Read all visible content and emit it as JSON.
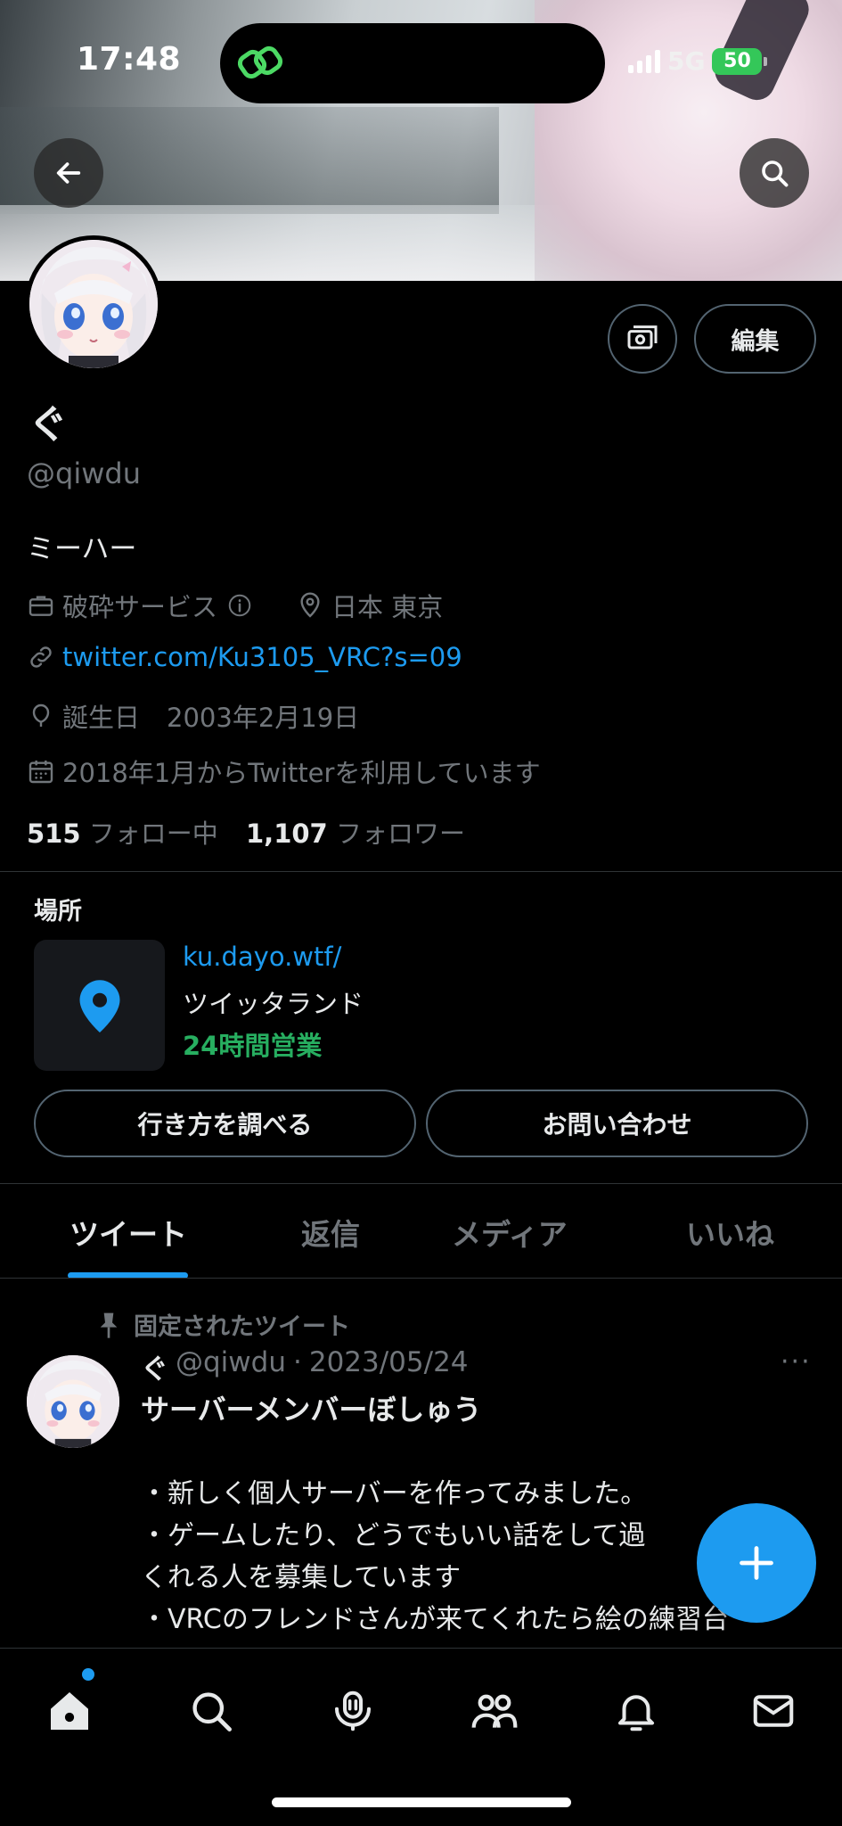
{
  "status_bar": {
    "time": "17:48",
    "network": "5G",
    "battery": "50"
  },
  "profile": {
    "name": "ぐ",
    "handle": "@qiwdu",
    "bio": "ミーハー",
    "category": "破砕サービス",
    "location": "日本 東京",
    "url": "twitter.com/Ku3105_VRC?s=09",
    "birthday_label": "誕生日",
    "birthday": "2003年2月19日",
    "joined": "2018年1月からTwitterを利用しています",
    "following_count": "515",
    "following_label": "フォロー中",
    "followers_count": "1,107",
    "followers_label": "フォロワー"
  },
  "header_buttons": {
    "edit_label": "編集"
  },
  "place": {
    "title": "場所",
    "url": "ku.dayo.wtf/",
    "name": "ツイッタランド",
    "hours": "24時間営業",
    "directions_label": "行き方を調べる",
    "contact_label": "お問い合わせ"
  },
  "tabs": [
    {
      "label": "ツイート",
      "active": true
    },
    {
      "label": "返信",
      "active": false
    },
    {
      "label": "メディア",
      "active": false
    },
    {
      "label": "いいね",
      "active": false
    }
  ],
  "pinned_tweet": {
    "pinned_label": "固定されたツイート",
    "author_name": "ぐ",
    "author_handle": "@qiwdu",
    "separator": "·",
    "date": "2023/05/24",
    "more": "···",
    "title": "サーバーメンバーぼしゅう",
    "lines": [
      "・新しく個人サーバーを作ってみました。",
      "・ゲームしたり、どうでもいい話をして過",
      "くれる人を募集しています",
      "・VRCのフレンドさんが来てくれたら絵の練習台"
    ]
  },
  "colors": {
    "accent": "#1d9bf0",
    "open_hours": "#27ae60",
    "muted": "#71767b",
    "background": "#000000"
  },
  "nav": [
    "home-icon",
    "search-icon",
    "spaces-icon",
    "communities-icon",
    "notifications-icon",
    "messages-icon"
  ]
}
